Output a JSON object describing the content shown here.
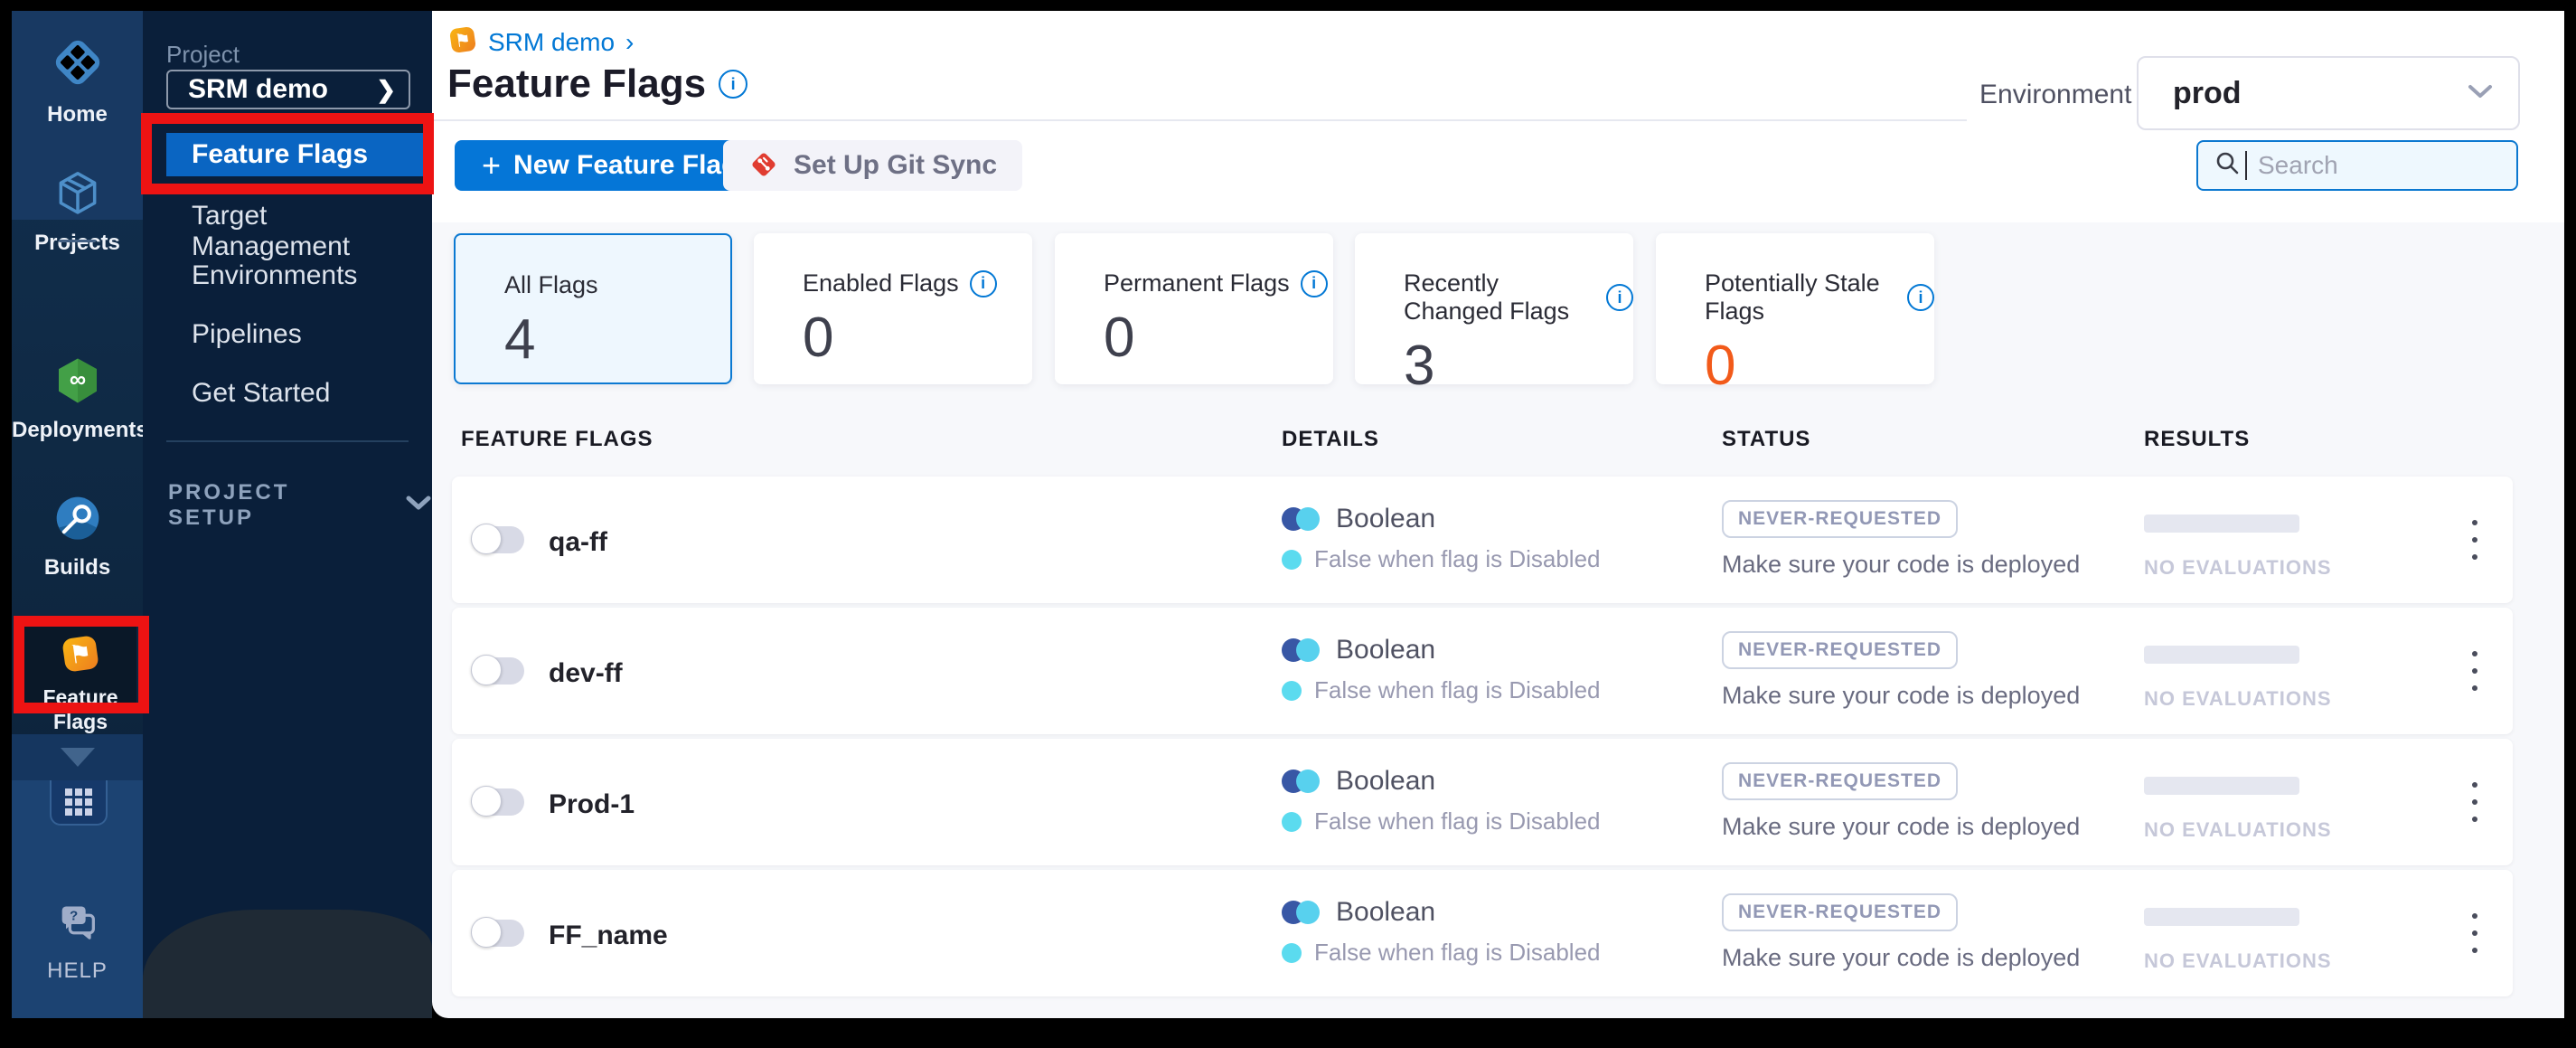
{
  "colors": {
    "accent_blue": "#0278d5",
    "sidebar_selected_blue": "#0a65c2",
    "primary_button_blue": "#0576d7",
    "stale_orange": "#f25a1a",
    "annotation_red": "#ed1313",
    "boolean_indigo": "#3857a5",
    "boolean_cyan": "#58d1ee"
  },
  "left_rail": {
    "items": [
      {
        "label": "Home"
      },
      {
        "label": "Projects"
      },
      {
        "label": "Deployments"
      },
      {
        "label": "Builds"
      },
      {
        "label": "Feature Flags"
      }
    ],
    "help_label": "HELP"
  },
  "sidebar": {
    "project_label": "Project",
    "project_name": "SRM demo",
    "project_chevron": "❯",
    "selected_item": "Feature Flags",
    "items": [
      "Target Management",
      "Environments",
      "Pipelines",
      "Get Started"
    ],
    "section_label": "PROJECT SETUP"
  },
  "header": {
    "breadcrumb": "SRM demo",
    "breadcrumb_separator": "›",
    "title": "Feature Flags",
    "environment_label": "Environment",
    "environment_value": "prod"
  },
  "toolbar": {
    "new_flag_plus": "+",
    "new_flag_label": "New Feature Flag",
    "git_sync_label": "Set Up Git Sync",
    "search_placeholder": "Search"
  },
  "cards": [
    {
      "label": "All Flags",
      "value": "4"
    },
    {
      "label": "Enabled Flags",
      "value": "0"
    },
    {
      "label": "Permanent Flags",
      "value": "0"
    },
    {
      "label": "Recently Changed Flags",
      "value": "3"
    },
    {
      "label": "Potentially Stale Flags",
      "value": "0"
    }
  ],
  "table": {
    "headers": {
      "flags": "FEATURE FLAGS",
      "details": "DETAILS",
      "status": "STATUS",
      "results": "RESULTS"
    },
    "rows": [
      {
        "name": "qa-ff",
        "type": "Boolean",
        "default_rule": "False when flag is Disabled",
        "status_badge": "NEVER-REQUESTED",
        "status_text": "Make sure your code is deployed",
        "results_text": "NO EVALUATIONS"
      },
      {
        "name": "dev-ff",
        "type": "Boolean",
        "default_rule": "False when flag is Disabled",
        "status_badge": "NEVER-REQUESTED",
        "status_text": "Make sure your code is deployed",
        "results_text": "NO EVALUATIONS"
      },
      {
        "name": "Prod-1",
        "type": "Boolean",
        "default_rule": "False when flag is Disabled",
        "status_badge": "NEVER-REQUESTED",
        "status_text": "Make sure your code is deployed",
        "results_text": "NO EVALUATIONS"
      },
      {
        "name": "FF_name",
        "type": "Boolean",
        "default_rule": "False when flag is Disabled",
        "status_badge": "NEVER-REQUESTED",
        "status_text": "Make sure your code is deployed",
        "results_text": "NO EVALUATIONS"
      }
    ]
  }
}
